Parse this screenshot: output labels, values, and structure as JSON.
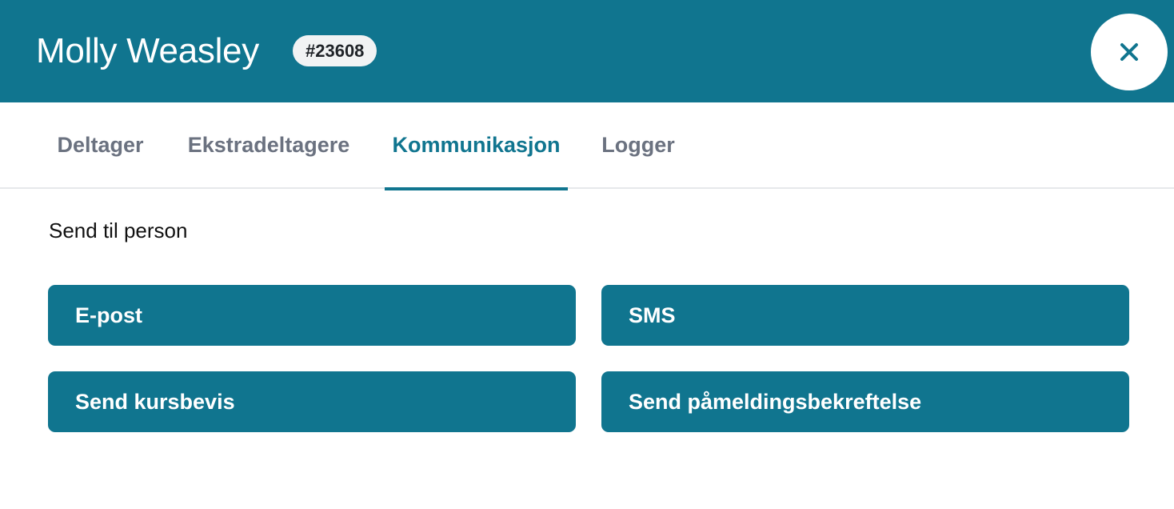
{
  "header": {
    "name": "Molly Weasley",
    "id_badge": "#23608",
    "close_icon": "close-icon"
  },
  "tabs": [
    {
      "label": "Deltager",
      "active": false
    },
    {
      "label": "Ekstradeltagere",
      "active": false
    },
    {
      "label": "Kommunikasjon",
      "active": true
    },
    {
      "label": "Logger",
      "active": false
    }
  ],
  "main": {
    "section_label": "Send til person",
    "buttons": {
      "email": "E-post",
      "sms": "SMS",
      "certificate": "Send kursbevis",
      "confirmation": "Send påmeldingsbekreftelse"
    }
  },
  "colors": {
    "primary": "#10758f",
    "tab_inactive": "#6b7280",
    "badge_bg": "#f1f3f4"
  }
}
